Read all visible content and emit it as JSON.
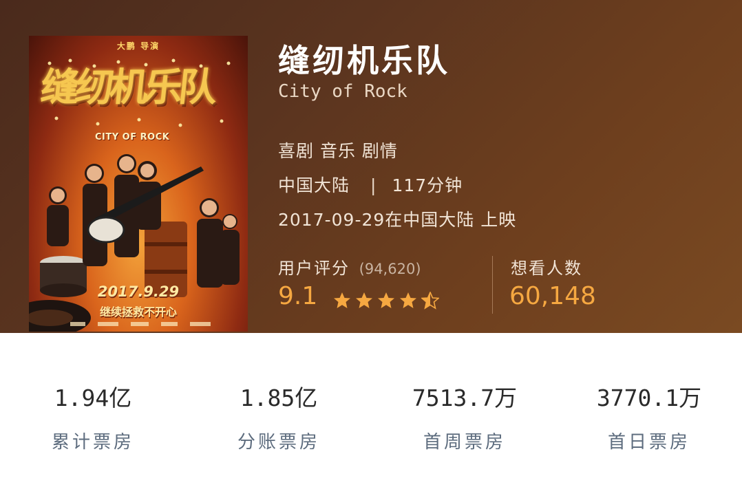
{
  "movie": {
    "title_cn": "缝纫机乐队",
    "title_en": "City of Rock",
    "genres": "喜剧 音乐 剧情",
    "region": "中国大陆",
    "separator": "|",
    "duration": "117分钟",
    "release": "2017-09-29在中国大陆 上映"
  },
  "poster": {
    "director_credit": "大鹏 导演",
    "title_art": "缝纫机乐队",
    "english_art": "CITY OF ROCK",
    "date": "2017.9.29",
    "tagline": "继续拯救不开心"
  },
  "rating": {
    "label": "用户评分",
    "count": "(94,620)",
    "score": "9.1",
    "stars": 4.5,
    "star_color": "#f6a841"
  },
  "want": {
    "label": "想看人数",
    "value": "60,148"
  },
  "box_office": [
    {
      "value": "1.94亿",
      "label": "累计票房"
    },
    {
      "value": "1.85亿",
      "label": "分账票房"
    },
    {
      "value": "7513.7万",
      "label": "首周票房"
    },
    {
      "value": "3770.1万",
      "label": "首日票房"
    }
  ],
  "colors": {
    "accent": "#f6a841",
    "hero_bg": "#5a341f",
    "stat_label": "#5d6c7e"
  }
}
